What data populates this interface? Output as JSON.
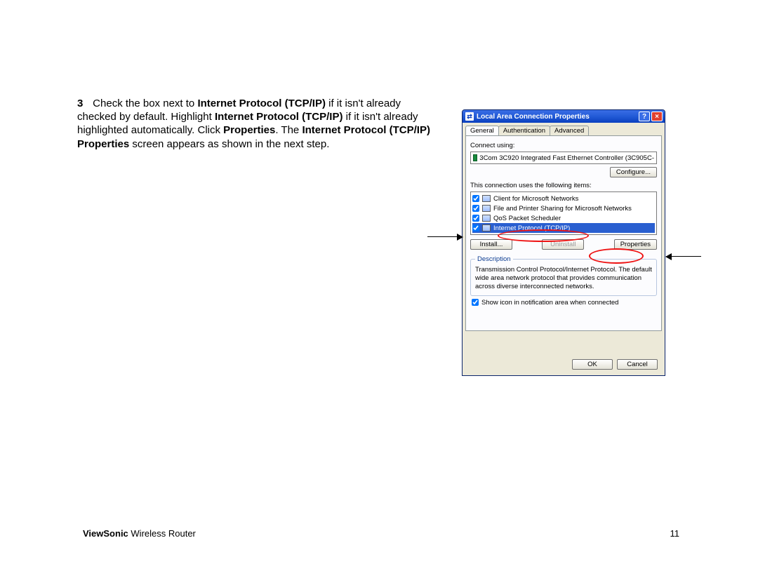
{
  "step": {
    "number": "3",
    "t1a": "Check the box next to ",
    "t1b": "Internet Protocol (TCP/IP)",
    "t1c": " if it isn't already checked by default. Highlight ",
    "t1d": "Internet Protocol (TCP/IP)",
    "t1e": " if it isn't already highlighted automatically. Click ",
    "t1f": "Properties",
    "t1g": ". The ",
    "t1h": "Internet Protocol (TCP/IP) Properties",
    "t1i": " screen appears as shown in the next step."
  },
  "footer": {
    "brand": "ViewSonic",
    "product": " Wireless Router",
    "page": "11"
  },
  "dlg": {
    "title": "Local Area Connection Properties",
    "tabs": {
      "general": "General",
      "auth": "Authentication",
      "adv": "Advanced"
    },
    "connect_using": "Connect using:",
    "nic": "3Com 3C920 Integrated Fast Ethernet Controller (3C905C-",
    "configure": "Configure...",
    "uses_items": "This connection uses the following items:",
    "items": [
      "Client for Microsoft Networks",
      "File and Printer Sharing for Microsoft Networks",
      "QoS Packet Scheduler",
      "Internet Protocol (TCP/IP)"
    ],
    "install": "Install...",
    "uninstall": "Uninstall",
    "properties": "Properties",
    "desc_legend": "Description",
    "desc_text": "Transmission Control Protocol/Internet Protocol. The default wide area network protocol that provides communication across diverse interconnected networks.",
    "show_icon": "Show icon in notification area when connected",
    "ok": "OK",
    "cancel": "Cancel"
  }
}
